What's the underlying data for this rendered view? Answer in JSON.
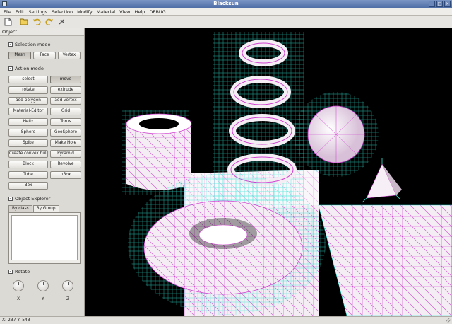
{
  "window": {
    "title": "Blacksun"
  },
  "menu": [
    "File",
    "Edit",
    "Settings",
    "Selection",
    "Modify",
    "Material",
    "View",
    "Help",
    "DEBUG"
  ],
  "toolbar": {
    "icons": [
      "new-file-icon",
      "open-file-icon",
      "undo-icon",
      "redo-icon",
      "tools-icon"
    ]
  },
  "panel": {
    "title": "Object",
    "selection_mode": {
      "label": "Selection mode",
      "checked": true,
      "buttons": [
        "Mesh",
        "Face",
        "Vertex"
      ],
      "active": "Mesh"
    },
    "action_mode": {
      "label": "Action mode",
      "checked": true,
      "buttons": [
        "select",
        "move",
        "rotate",
        "extrude",
        "add polygon",
        "add vertex",
        "Material-Editor",
        "Grid",
        "Helix",
        "Torus",
        "Sphere",
        "GeoSphere",
        "Spike",
        "Make Hole",
        "Create convex hull",
        "Pyramid",
        "Block",
        "Revolve",
        "Tube",
        "nBox",
        "Box"
      ],
      "active": "move"
    },
    "object_explorer": {
      "label": "Object Explorer",
      "checked": true,
      "tabs": [
        "By class",
        "By Group"
      ],
      "active_tab": "By Group"
    },
    "rotate": {
      "label": "Rotate",
      "checked": true,
      "dials": [
        "X",
        "Y",
        "Z"
      ]
    }
  },
  "status": {
    "coords": "X: 237  Y: 543"
  },
  "colors": {
    "mesh_lines": "#e040e0",
    "normals": "#35e8d8",
    "surface": "#f4eef4",
    "viewport_bg": "#000000"
  }
}
